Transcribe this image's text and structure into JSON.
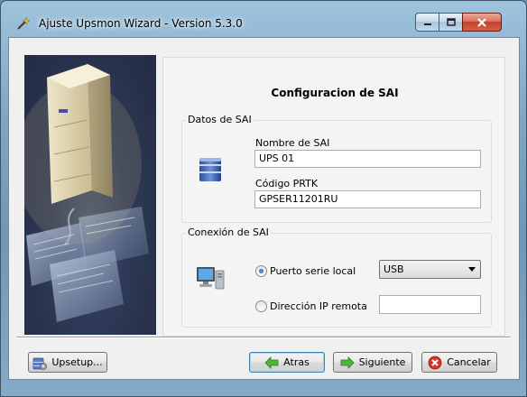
{
  "window": {
    "title": "Ajuste Upsmon Wizard - Version 5.3.0",
    "accent": "#3c7fb1"
  },
  "panel": {
    "title": "Configuracion de SAI",
    "datos_group": {
      "label": "Datos de SAI",
      "icon": "ups-database-icon",
      "name_label": "Nombre de SAI",
      "name_value": "UPS 01",
      "prtk_label": "Código PRTK",
      "prtk_value": "GPSER11201RU"
    },
    "conexion_group": {
      "label": "Conexión de SAI",
      "icon": "computer-icon",
      "serial_label": "Puerto serie local",
      "serial_checked": true,
      "port_selected": "USB",
      "ip_label": "Dirección IP remota",
      "ip_value": ""
    }
  },
  "buttons": {
    "upsetup": "Upsetup...",
    "back": "Atras",
    "next": "Siguiente",
    "cancel": "Cancelar"
  }
}
